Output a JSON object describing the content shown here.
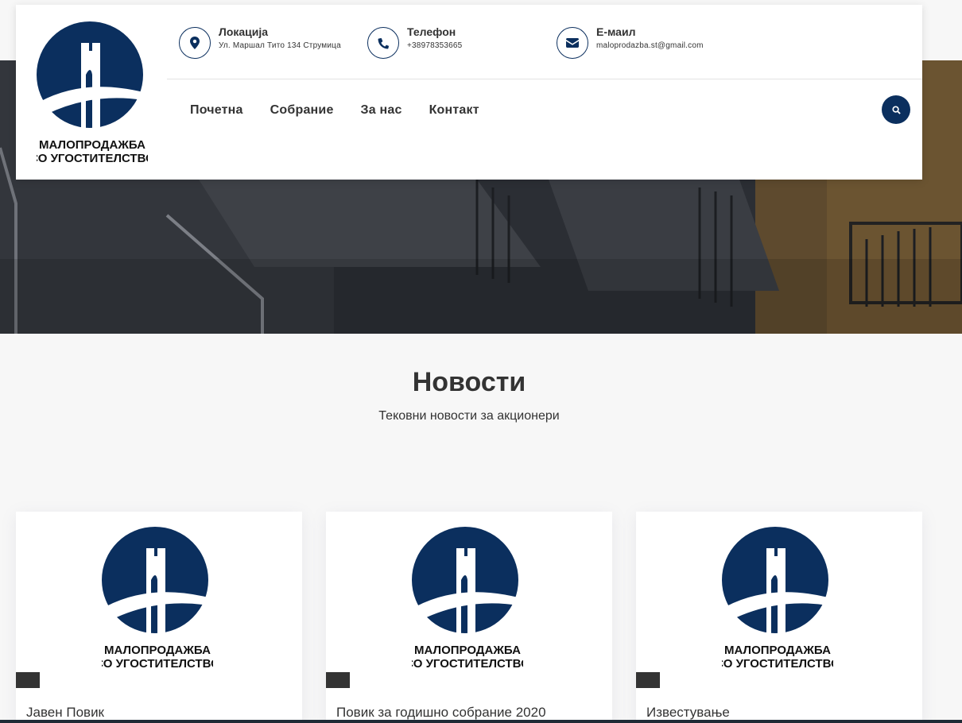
{
  "header": {
    "contacts": [
      {
        "label": "Локација",
        "value": "Ул. Маршал Тито 134 Струмица",
        "icon": "map-pin-icon"
      },
      {
        "label": "Телефон",
        "value": "+38978353665",
        "icon": "phone-icon"
      },
      {
        "label": "Е-маил",
        "value": "maloprodazba.st@gmail.com",
        "icon": "envelope-icon"
      }
    ],
    "nav": [
      "Почетна",
      "Собрание",
      "За нас",
      "Контакт"
    ],
    "search_icon": "search-icon"
  },
  "logo": {
    "line1": "МАЛОПРОДАЖБА",
    "line2": "СО УГОСТИТЕЛСТВО"
  },
  "colors": {
    "brand": "#0b2f5e",
    "text": "#333333"
  },
  "section": {
    "title": "Новости",
    "subtitle": "Тековни новости за акционери"
  },
  "cards": [
    {
      "title": "Јавен Повик"
    },
    {
      "title": "Повик за годишно собрание 2020"
    },
    {
      "title": "Известување"
    }
  ]
}
